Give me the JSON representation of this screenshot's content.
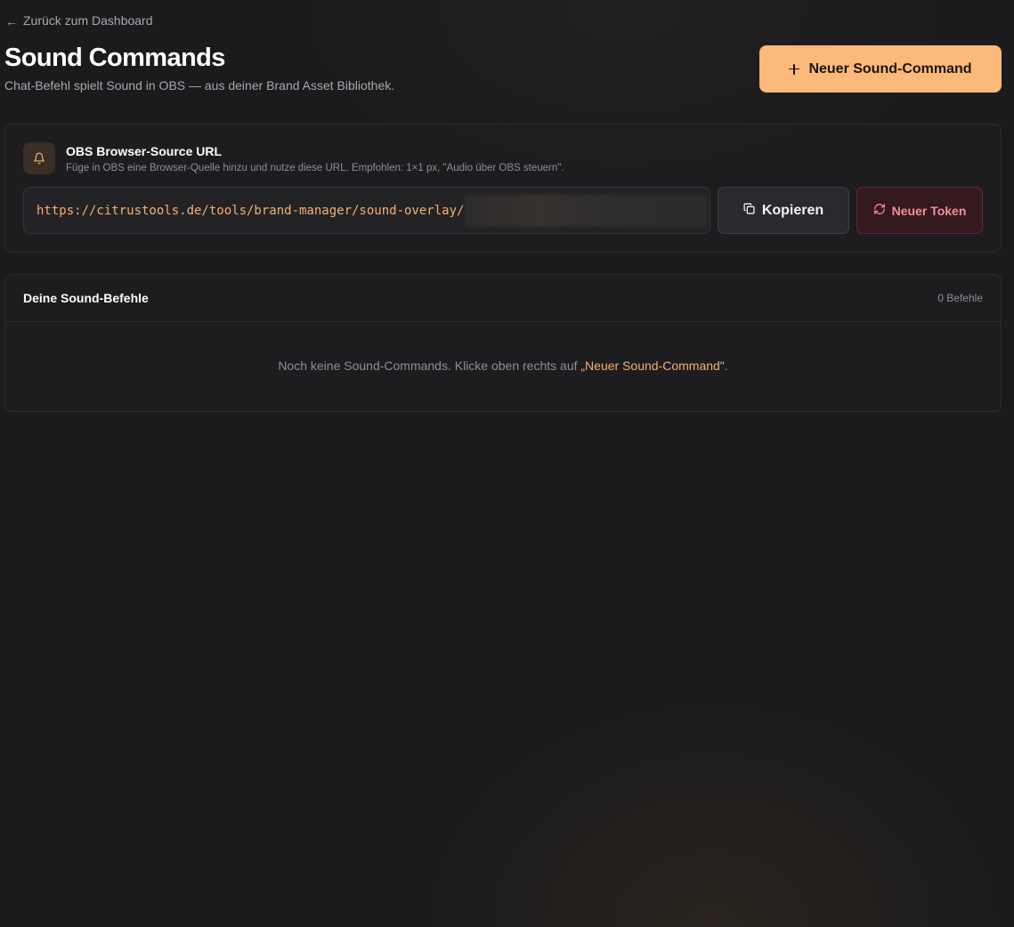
{
  "nav": {
    "back_arrow": "←",
    "back_label": "Zurück zum Dashboard"
  },
  "header": {
    "title": "Sound Commands",
    "subtitle": "Chat-Befehl spielt Sound in OBS — aus deiner Brand Asset Bibliothek.",
    "new_button_label": "Neuer Sound-Command",
    "new_button_icon": "plus-icon"
  },
  "obs_card": {
    "icon": "bell-icon",
    "title": "OBS Browser-Source URL",
    "description": "Füge in OBS eine Browser-Quelle hinzu und nutze diese URL. Empfohlen: 1×1 px, \"Audio über OBS steuern\".",
    "url_visible": "https://citrustools.de/tools/brand-manager/sound-overlay/",
    "url_token_redacted": true,
    "copy_button_label": "Kopieren",
    "copy_button_icon": "copy-icon",
    "token_button_label": "Neuer Token",
    "token_button_icon": "refresh-icon"
  },
  "list_card": {
    "title": "Deine Sound-Befehle",
    "count_label": "0 Befehle",
    "empty_prefix": "Noch keine Sound-Commands. Klicke oben rechts auf ",
    "empty_link": "„Neuer Sound-Command\"",
    "empty_suffix": "."
  },
  "colors": {
    "background": "#1b1b1d",
    "accent": "#fdb979",
    "url_text": "#f3b074",
    "danger_text": "#f08e9a",
    "danger_bg": "#34191f"
  }
}
